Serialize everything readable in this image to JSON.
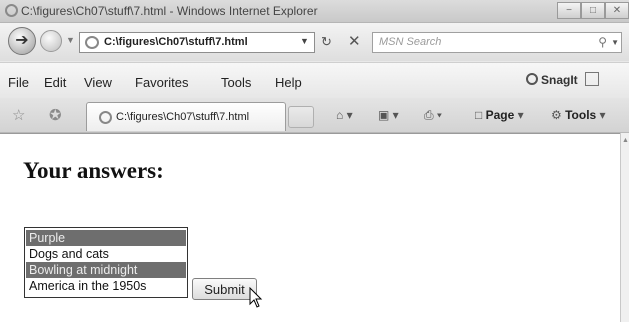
{
  "window": {
    "title": "C:\\figures\\Ch07\\stuff\\7.html - Windows Internet Explorer",
    "controls": [
      "minimize",
      "maximize",
      "close"
    ]
  },
  "address_bar": {
    "url": "C:\\figures\\Ch07\\stuff\\7.html",
    "search_placeholder": "MSN Search"
  },
  "menu": {
    "items": [
      "File",
      "Edit",
      "View",
      "Favorites",
      "Tools",
      "Help"
    ],
    "snagit_label": "SnagIt"
  },
  "tab": {
    "label": "C:\\figures\\Ch07\\stuff\\7.html"
  },
  "commands": {
    "page_label": "Page",
    "tools_label": "Tools"
  },
  "page": {
    "heading": "Your answers:",
    "options": [
      {
        "label": "Purple",
        "selected": true
      },
      {
        "label": "Dogs and cats",
        "selected": false
      },
      {
        "label": "Bowling at midnight",
        "selected": true
      },
      {
        "label": "America in the 1950s",
        "selected": false
      }
    ],
    "submit_label": "Submit"
  },
  "icons": [
    "ie-logo-icon",
    "back-icon",
    "forward-icon",
    "refresh-icon",
    "stop-icon",
    "search-icon",
    "favorites-star-icon",
    "add-favorites-icon",
    "home-icon",
    "feeds-icon",
    "print-icon",
    "page-icon",
    "tools-icon",
    "snagit-icon",
    "mouse-pointer-icon"
  ],
  "colors": {
    "selected_option_bg": "#6e6e6e",
    "selected_option_text": "#ececec"
  }
}
